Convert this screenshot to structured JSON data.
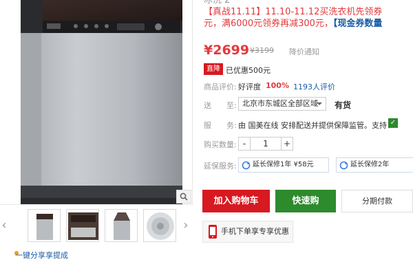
{
  "promo": {
    "line1_cut": "冰洗 2",
    "line2_tag": "【真战11.11】",
    "line2_text": "11.10-11.12买洗衣机先领券",
    "line3_text": "元，满6000元领券再减300元，",
    "line3_link": "【现金券数量"
  },
  "price": {
    "current": "¥2699",
    "original": "¥3199",
    "notify": "降价通知"
  },
  "discount": {
    "badge": "直降",
    "text": "已优惠500元"
  },
  "rating": {
    "label": "商品评价:",
    "good_label": "好评度",
    "good_value": "100%",
    "reviews": "1193人评价"
  },
  "delivery": {
    "label": "送　　至:",
    "region": "北京市东城区全部区域",
    "stock": "有货"
  },
  "service": {
    "label": "服　　务:",
    "text": "由  国美在线 安排配送并提供保障监管。支持："
  },
  "quantity": {
    "label": "购买数量:",
    "minus": "-",
    "value": "1",
    "plus": "+"
  },
  "warranty": {
    "label": "延保服务:",
    "options": [
      "延长保修1年  ¥58元",
      "延长保修2年"
    ]
  },
  "actions": {
    "add_to_cart": "加入购物车",
    "buy_now": "快速购",
    "installment": "分期付款"
  },
  "mobile_promo": "手机下单享专享优惠",
  "share": "一键分享享提成",
  "colors": {
    "accent_red": "#e4393c",
    "cart_red": "#d71920",
    "buy_green": "#2d8a2d",
    "link_blue": "#1a5ba6"
  },
  "icons": [
    "zoom-icon",
    "chevron-left-icon",
    "chevron-right-icon",
    "share-icon",
    "refresh-icon",
    "mobile-phone-icon",
    "check-icon"
  ]
}
